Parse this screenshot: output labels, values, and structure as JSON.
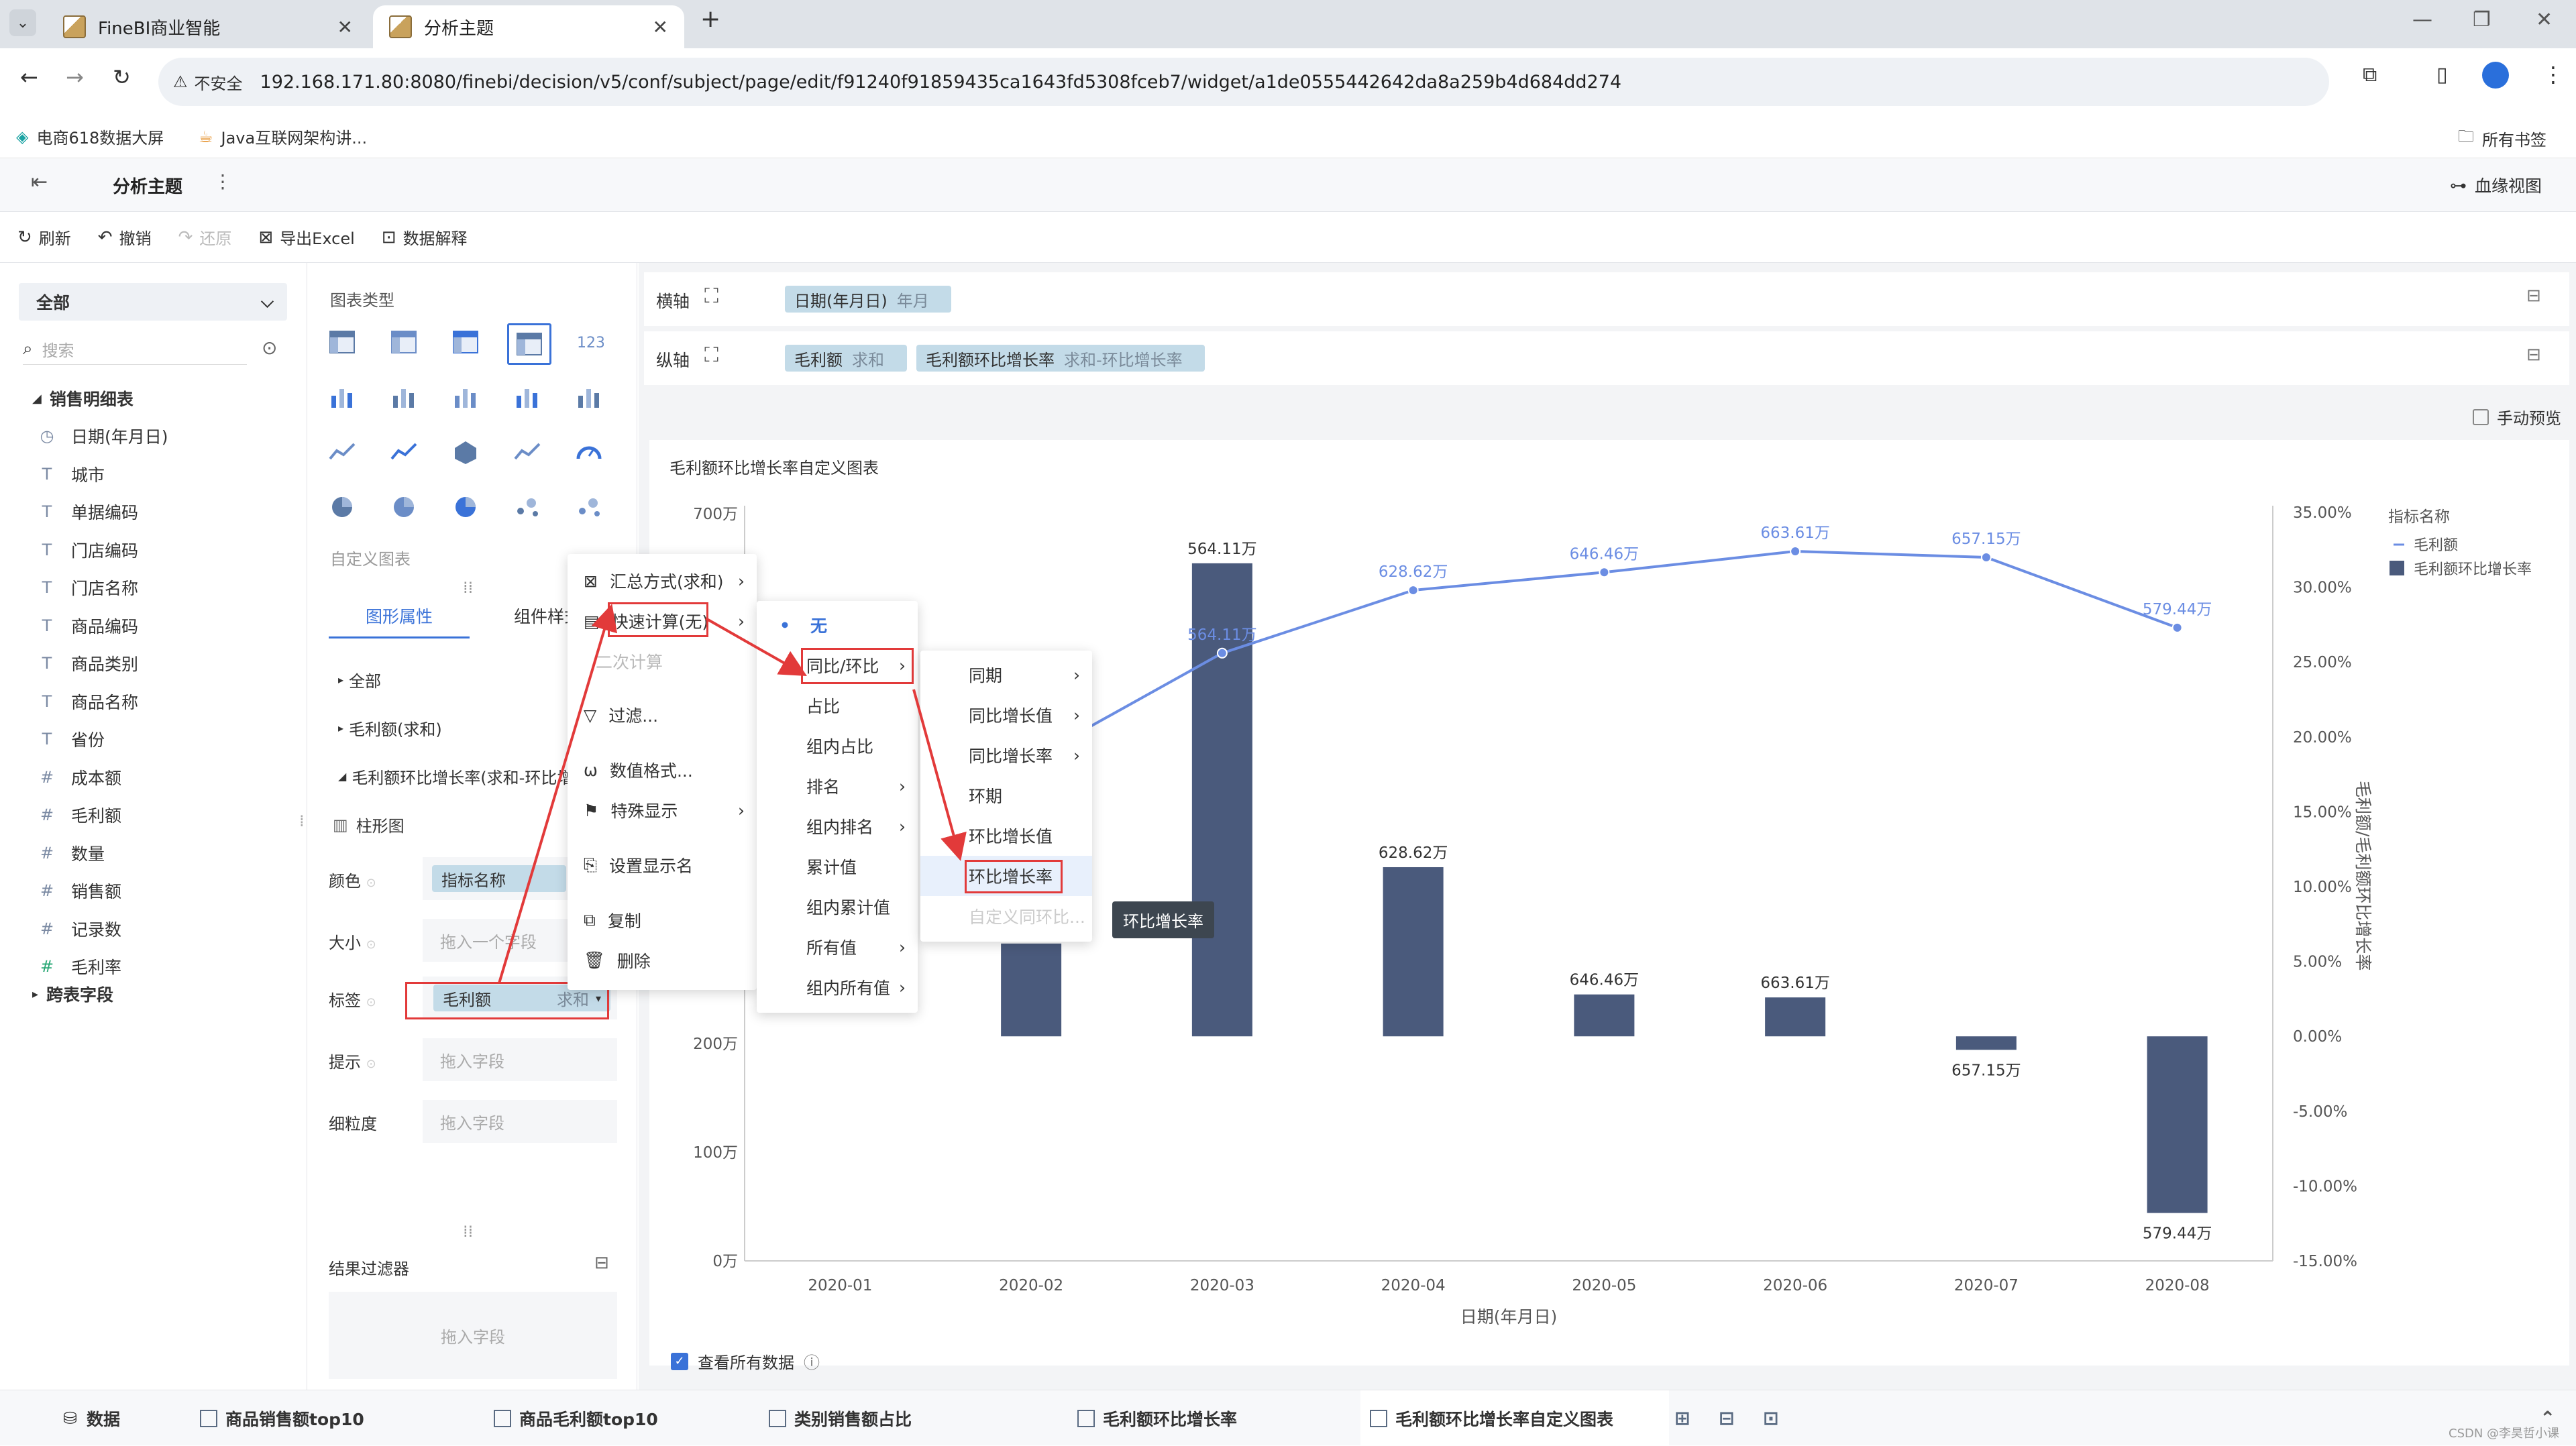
{
  "browser": {
    "tabs": [
      {
        "title": "FineBI商业智能"
      },
      {
        "title": "分析主题"
      }
    ],
    "new_tab": "+",
    "security": "不安全",
    "url": "192.168.171.80:8080/finebi/decision/v5/conf/subject/page/edit/f91240f91859435ca1643fd5308fceb7/widget/a1de0555442642da8a259b4d684dd274",
    "bookmarks": [
      "电商618数据大屏",
      "Java互联网架构讲..."
    ],
    "all_bookmarks": "所有书签"
  },
  "app": {
    "title": "分析主题",
    "lineage": "血缘视图",
    "toolbar": {
      "refresh": "刷新",
      "undo": "撤销",
      "redo": "还原",
      "export": "导出Excel",
      "explain": "数据解释"
    }
  },
  "data_panel": {
    "scope": "全部",
    "search_placeholder": "搜索",
    "table_name": "销售明细表",
    "fields": [
      {
        "icon": "clock",
        "name": "日期(年月日)"
      },
      {
        "icon": "T",
        "name": "城市"
      },
      {
        "icon": "T",
        "name": "单据编码"
      },
      {
        "icon": "T",
        "name": "门店编码"
      },
      {
        "icon": "T",
        "name": "门店名称"
      },
      {
        "icon": "T",
        "name": "商品编码"
      },
      {
        "icon": "T",
        "name": "商品类别"
      },
      {
        "icon": "T",
        "name": "商品名称"
      },
      {
        "icon": "T",
        "name": "省份"
      },
      {
        "icon": "#",
        "name": "成本额"
      },
      {
        "icon": "#",
        "name": "毛利额"
      },
      {
        "icon": "#",
        "name": "数量"
      },
      {
        "icon": "#",
        "name": "销售额"
      },
      {
        "icon": "#",
        "name": "记录数"
      },
      {
        "icon": "#f",
        "name": "毛利率"
      }
    ],
    "cross_table": "跨表字段"
  },
  "config_panel": {
    "chart_type_label": "图表类型",
    "custom_chart_label": "自定义图表",
    "tabs": [
      "图形属性",
      "组件样式"
    ],
    "sections": [
      "全部",
      "毛利额(求和)",
      "毛利额环比增长率(求和-环比增长率)"
    ],
    "chart_kind": "柱形图",
    "props": {
      "color_label": "颜色",
      "color_value": "指标名称",
      "size_label": "大小",
      "size_placeholder": "拖入一个字段",
      "label_label": "标签",
      "label_field": "毛利额",
      "label_agg": "求和",
      "tooltip_label": "提示",
      "tooltip_placeholder": "拖入字段",
      "granularity_label": "细粒度",
      "granularity_placeholder": "拖入字段"
    },
    "result_filter": "结果过滤器",
    "result_filter_placeholder": "拖入字段"
  },
  "axes": {
    "x_label": "横轴",
    "y_label": "纵轴",
    "x_pill": {
      "field": "日期(年月日)",
      "sub": "年月"
    },
    "y_pills": [
      {
        "field": "毛利额",
        "sub": "求和"
      },
      {
        "field": "毛利额环比增长率",
        "sub": "求和-环比增长率"
      }
    ],
    "manual_preview": "手动预览"
  },
  "context_menu": {
    "items": [
      "汇总方式(求和)",
      "快速计算(无)",
      "二次计算",
      "过滤...",
      "数值格式...",
      "特殊显示",
      "设置显示名",
      "复制",
      "删除"
    ],
    "quick_calc": [
      "无",
      "同比/环比",
      "占比",
      "组内占比",
      "排名",
      "组内排名",
      "累计值",
      "组内累计值",
      "所有值",
      "组内所有值"
    ],
    "yoy": [
      "同期",
      "同比增长值",
      "同比增长率",
      "环期",
      "环比增长值",
      "环比增长率",
      "自定义同环比..."
    ],
    "tooltip": "环比增长率"
  },
  "footer": {
    "view_all": "查看所有数据",
    "tabs": [
      "数据",
      "商品销售额top10",
      "商品毛利额top10",
      "类别销售额占比",
      "毛利额环比增长率",
      "毛利额环比增长率自定义图表"
    ],
    "watermark": "CSDN @李昊哲小课"
  },
  "chart_data": {
    "type": "bar",
    "title": "毛利额环比增长率自定义图表",
    "xlabel": "日期(年月日)",
    "ylabel_right": "毛利额/毛利额环比增长率",
    "categories": [
      "2020-01",
      "2020-02",
      "2020-03",
      "2020-04",
      "2020-05",
      "2020-06",
      "2020-07",
      "2020-08"
    ],
    "left_ticks": [
      "0万",
      "100万",
      "200万",
      "700万"
    ],
    "right_ticks": [
      "35.00%",
      "30.00%",
      "25.00%",
      "20.00%",
      "15.00%",
      "10.00%",
      "5.00%",
      "0.00%",
      "-5.00%",
      "-10.00%",
      "-15.00%"
    ],
    "right_range": [
      -15,
      35
    ],
    "legend_title": "指标名称",
    "series": [
      {
        "name": "毛利额",
        "kind": "line",
        "color": "#6b8de3",
        "values": [
          null,
          18.5,
          25.6,
          29.8,
          31.0,
          32.4,
          32.0,
          27.3
        ],
        "labels": [
          "",
          "",
          "564.11万",
          "628.62万",
          "646.46万",
          "663.61万",
          "657.15万",
          "579.44万"
        ]
      },
      {
        "name": "毛利额环比增长率",
        "kind": "bar",
        "color": "#4a5a7c",
        "values": [
          null,
          6.2,
          31.6,
          11.3,
          2.8,
          2.6,
          -0.9,
          -11.8
        ],
        "labels": [
          "",
          "",
          "564.11万",
          "628.62万",
          "646.46万",
          "663.61万",
          "657.15万",
          "579.44万"
        ]
      }
    ]
  }
}
